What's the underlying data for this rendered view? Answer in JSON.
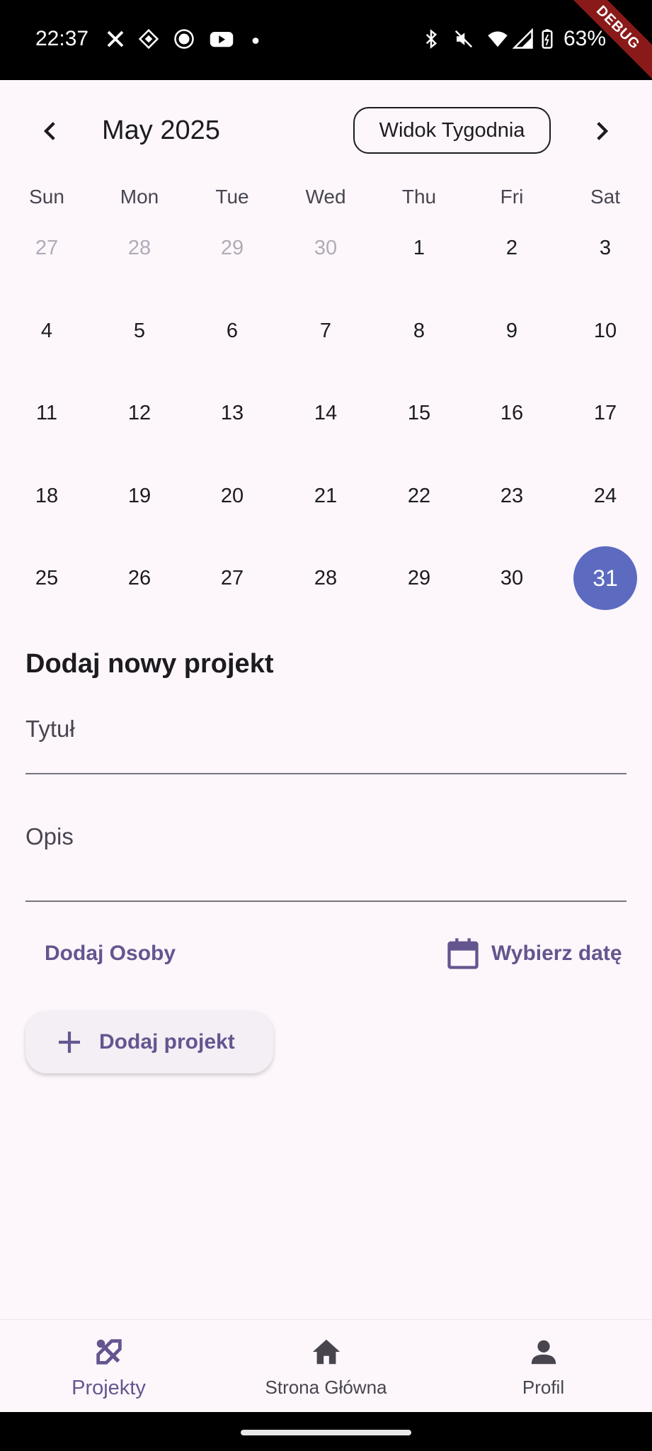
{
  "status_bar": {
    "time": "22:37",
    "battery": "63%",
    "debug_label": "DEBUG",
    "notification_icons": [
      "x-icon",
      "grid-app-icon",
      "badge-63-icon",
      "youtube-icon",
      "dot-icon"
    ],
    "system_icons": [
      "bluetooth-icon",
      "mute-icon",
      "wifi-icon",
      "signal-icon",
      "battery-icon"
    ]
  },
  "calendar": {
    "month_title": "May 2025",
    "week_view_label": "Widok Tygodnia",
    "weekdays": [
      "Sun",
      "Mon",
      "Tue",
      "Wed",
      "Thu",
      "Fri",
      "Sat"
    ],
    "weeks": [
      [
        {
          "d": "27",
          "out": true
        },
        {
          "d": "28",
          "out": true
        },
        {
          "d": "29",
          "out": true
        },
        {
          "d": "30",
          "out": true
        },
        {
          "d": "1"
        },
        {
          "d": "2"
        },
        {
          "d": "3"
        }
      ],
      [
        {
          "d": "4"
        },
        {
          "d": "5"
        },
        {
          "d": "6"
        },
        {
          "d": "7"
        },
        {
          "d": "8"
        },
        {
          "d": "9"
        },
        {
          "d": "10"
        }
      ],
      [
        {
          "d": "11"
        },
        {
          "d": "12"
        },
        {
          "d": "13"
        },
        {
          "d": "14"
        },
        {
          "d": "15"
        },
        {
          "d": "16"
        },
        {
          "d": "17"
        }
      ],
      [
        {
          "d": "18"
        },
        {
          "d": "19"
        },
        {
          "d": "20"
        },
        {
          "d": "21"
        },
        {
          "d": "22"
        },
        {
          "d": "23"
        },
        {
          "d": "24"
        }
      ],
      [
        {
          "d": "25"
        },
        {
          "d": "26"
        },
        {
          "d": "27"
        },
        {
          "d": "28"
        },
        {
          "d": "29"
        },
        {
          "d": "30"
        },
        {
          "d": "31",
          "selected": true
        }
      ]
    ],
    "selected_day": "31",
    "selected_color": "#5c6bc0"
  },
  "form": {
    "title": "Dodaj nowy projekt",
    "title_field_label": "Tytuł",
    "description_field_label": "Opis",
    "add_people_label": "Dodaj Osoby",
    "pick_date_label": "Wybierz datę",
    "add_project_label": "Dodaj projekt",
    "accent_color": "#65558f"
  },
  "bottom_nav": {
    "items": [
      {
        "label": "Projekty",
        "icon": "tools-icon",
        "active": true
      },
      {
        "label": "Strona Główna",
        "icon": "home-icon",
        "active": false
      },
      {
        "label": "Profil",
        "icon": "person-icon",
        "active": false
      }
    ]
  }
}
